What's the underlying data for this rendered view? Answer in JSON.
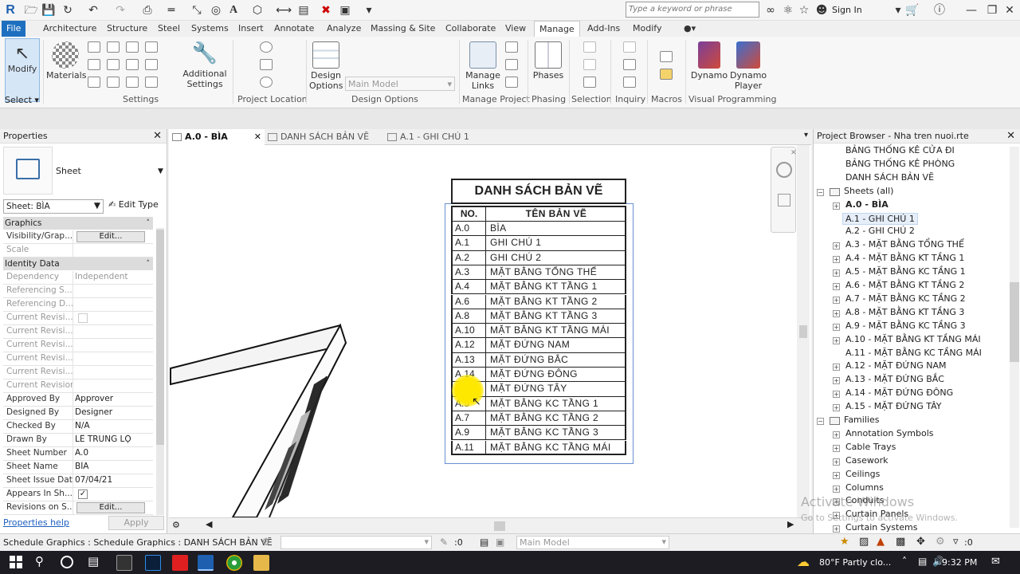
{
  "qat": {
    "search_placeholder": "Type a keyword or phrase",
    "sign_in": "Sign In"
  },
  "ribbon_tabs": [
    "File",
    "Architecture",
    "Structure",
    "Steel",
    "Systems",
    "Insert",
    "Annotate",
    "Analyze",
    "Massing & Site",
    "Collaborate",
    "View",
    "Manage",
    "Add-Ins",
    "Modify"
  ],
  "active_tab": "Manage",
  "ribbon": {
    "modify": "Modify",
    "select": "Select",
    "materials": "Materials",
    "additional_settings": "Additional Settings",
    "settings_label": "Settings",
    "project_location_label": "Project Location",
    "design_options": "Design Options",
    "main_model": "Main Model",
    "design_options_label": "Design Options",
    "manage_links": "Manage Links",
    "manage_project_label": "Manage Project",
    "phases": "Phases",
    "phasing_label": "Phasing",
    "selection_label": "Selection",
    "inquiry_label": "Inquiry",
    "macros_label": "Macros",
    "dynamo": "Dynamo",
    "dynamo_player": "Dynamo Player",
    "visual_programming_label": "Visual Programming"
  },
  "properties": {
    "title": "Properties",
    "type_name": "Sheet",
    "selector": "Sheet: BÌA",
    "edit_type": "Edit Type",
    "help": "Properties help",
    "apply": "Apply",
    "sections": {
      "graphics": "Graphics",
      "identity": "Identity Data"
    },
    "graphics_rows": [
      {
        "k": "Visibility/Grap...",
        "v": "Edit...",
        "button": true
      },
      {
        "k": "Scale",
        "v": "",
        "dis": true
      }
    ],
    "identity_rows": [
      {
        "k": "Dependency",
        "v": "Independent",
        "dis": true
      },
      {
        "k": "Referencing S...",
        "v": "",
        "dis": true
      },
      {
        "k": "Referencing D...",
        "v": "",
        "dis": true
      },
      {
        "k": "Current Revisi...",
        "v": "",
        "dis": true,
        "check": "false"
      },
      {
        "k": "Current Revisi...",
        "v": "",
        "dis": true
      },
      {
        "k": "Current Revisi...",
        "v": "",
        "dis": true
      },
      {
        "k": "Current Revisi...",
        "v": "",
        "dis": true
      },
      {
        "k": "Current Revisi...",
        "v": "",
        "dis": true
      },
      {
        "k": "Current Revision",
        "v": "",
        "dis": true
      },
      {
        "k": "Approved By",
        "v": "Approver"
      },
      {
        "k": "Designed By",
        "v": "Designer"
      },
      {
        "k": "Checked By",
        "v": "N/A"
      },
      {
        "k": "Drawn By",
        "v": "LÊ TRUNG LỘ"
      },
      {
        "k": "Sheet Number",
        "v": "A.0"
      },
      {
        "k": "Sheet Name",
        "v": "BÌA"
      },
      {
        "k": "Sheet Issue Date",
        "v": "07/04/21"
      },
      {
        "k": "Appears In Sh...",
        "v": "",
        "check": "true"
      },
      {
        "k": "Revisions on S...",
        "v": "Edit...",
        "button": true
      }
    ]
  },
  "view_tabs": [
    {
      "label": "A.0 - BÌA",
      "active": true
    },
    {
      "label": "DANH SÁCH BẢN VẼ",
      "active": false
    },
    {
      "label": "A.1 - GHI CHÚ 1",
      "active": false
    }
  ],
  "schedule": {
    "title": "DANH SÁCH BẢN VẼ",
    "headers": [
      "NO.",
      "TÊN BẢN VẼ"
    ],
    "rows": [
      [
        "A.0",
        "BÌA"
      ],
      [
        "A.1",
        "GHI CHÚ 1"
      ],
      [
        "A.2",
        "GHI CHÚ 2"
      ],
      [
        "A.3",
        "MẶT BẰNG TỔNG THỂ"
      ],
      [
        "A.4",
        "MẶT BẰNG KT TẦNG 1"
      ],
      [
        "A.6",
        "MẶT BẰNG KT TẦNG 2"
      ],
      [
        "A.8",
        "MẶT BẰNG KT TẦNG 3"
      ],
      [
        "A.10",
        "MẶT BẰNG KT TẦNG MÁI"
      ],
      [
        "A.12",
        "MẶT ĐỨNG NAM"
      ],
      [
        "A.13",
        "MẶT ĐỨNG BẮC"
      ],
      [
        "A.14",
        "MẶT ĐỨNG ĐÔNG"
      ],
      [
        "A.15",
        "MẶT ĐỨNG TÂY"
      ],
      [
        "A.5",
        "MẶT BẰNG KC TẦNG 1"
      ],
      [
        "A.7",
        "MẶT BẰNG KC TẦNG 2"
      ],
      [
        "A.9",
        "MẶT BẰNG KC TẦNG 3"
      ],
      [
        "A.11",
        "MẶT BẰNG KC TẦNG MÁI"
      ]
    ]
  },
  "browser": {
    "title": "Project Browser - Nha tren nuoi.rte",
    "items": [
      {
        "label": "BẢNG THỐNG KÊ CỬA ĐI",
        "level": 2,
        "toggle": ""
      },
      {
        "label": "BẢNG THỐNG KÊ PHÒNG",
        "level": 2,
        "toggle": ""
      },
      {
        "label": "DANH SÁCH BẢN VẼ",
        "level": 2,
        "toggle": ""
      },
      {
        "label": "Sheets (all)",
        "level": 0,
        "toggle": "-",
        "icon": true
      },
      {
        "label": "A.0 - BÌA",
        "level": 1,
        "toggle": "+",
        "bold": true
      },
      {
        "label": "A.1 - GHI CHÚ 1",
        "level": 2,
        "toggle": "",
        "selected": true
      },
      {
        "label": "A.2 - GHI CHÚ 2",
        "level": 2,
        "toggle": ""
      },
      {
        "label": "A.3 - MẶT BẰNG TỔNG THỂ",
        "level": 1,
        "toggle": "+"
      },
      {
        "label": "A.4 - MẶT BẰNG KT TẦNG 1",
        "level": 1,
        "toggle": "+"
      },
      {
        "label": "A.5 - MẶT BẰNG KC TẦNG 1",
        "level": 1,
        "toggle": "+"
      },
      {
        "label": "A.6 - MẶT BẰNG KT TẦNG 2",
        "level": 1,
        "toggle": "+"
      },
      {
        "label": "A.7 - MẶT BẰNG KC TẦNG 2",
        "level": 1,
        "toggle": "+"
      },
      {
        "label": "A.8 - MẶT BẰNG KT TẦNG 3",
        "level": 1,
        "toggle": "+"
      },
      {
        "label": "A.9 - MẶT BẰNG KC TẦNG 3",
        "level": 1,
        "toggle": "+"
      },
      {
        "label": "A.10 - MẶT BẰNG KT TẦNG MÁI",
        "level": 1,
        "toggle": "+"
      },
      {
        "label": "A.11 - MẶT BẰNG KC TẦNG MÁI",
        "level": 2,
        "toggle": ""
      },
      {
        "label": "A.12 - MẶT ĐỨNG NAM",
        "level": 1,
        "toggle": "+"
      },
      {
        "label": "A.13 - MẶT ĐỨNG BẮC",
        "level": 1,
        "toggle": "+"
      },
      {
        "label": "A.14 - MẶT ĐỨNG ĐÔNG",
        "level": 1,
        "toggle": "+"
      },
      {
        "label": "A.15 - MẶT ĐỨNG TÂY",
        "level": 1,
        "toggle": "+"
      },
      {
        "label": "Families",
        "level": 0,
        "toggle": "-",
        "icon": true
      },
      {
        "label": "Annotation Symbols",
        "level": 1,
        "toggle": "+"
      },
      {
        "label": "Cable Trays",
        "level": 1,
        "toggle": "+"
      },
      {
        "label": "Casework",
        "level": 1,
        "toggle": "+"
      },
      {
        "label": "Ceilings",
        "level": 1,
        "toggle": "+"
      },
      {
        "label": "Columns",
        "level": 1,
        "toggle": "+"
      },
      {
        "label": "Conduits",
        "level": 1,
        "toggle": "+"
      },
      {
        "label": "Curtain Panels",
        "level": 1,
        "toggle": "+"
      },
      {
        "label": "Curtain Systems",
        "level": 1,
        "toggle": "+"
      }
    ],
    "watermark1": "Activate Windows",
    "watermark2": "Go to Settings to activate Windows."
  },
  "status": {
    "text": "Schedule Graphics : Schedule Graphics : DANH SÁCH BẢN VẼ",
    "count": ":0",
    "model": "Main Model",
    "filter_count": ":0"
  },
  "taskbar": {
    "weather": "80°F  Partly clo...",
    "time": "9:32 PM"
  },
  "colors": {
    "file_tab": "#1e6fc0",
    "highlight": "#ffe800",
    "selection": "#6a8fd0"
  }
}
